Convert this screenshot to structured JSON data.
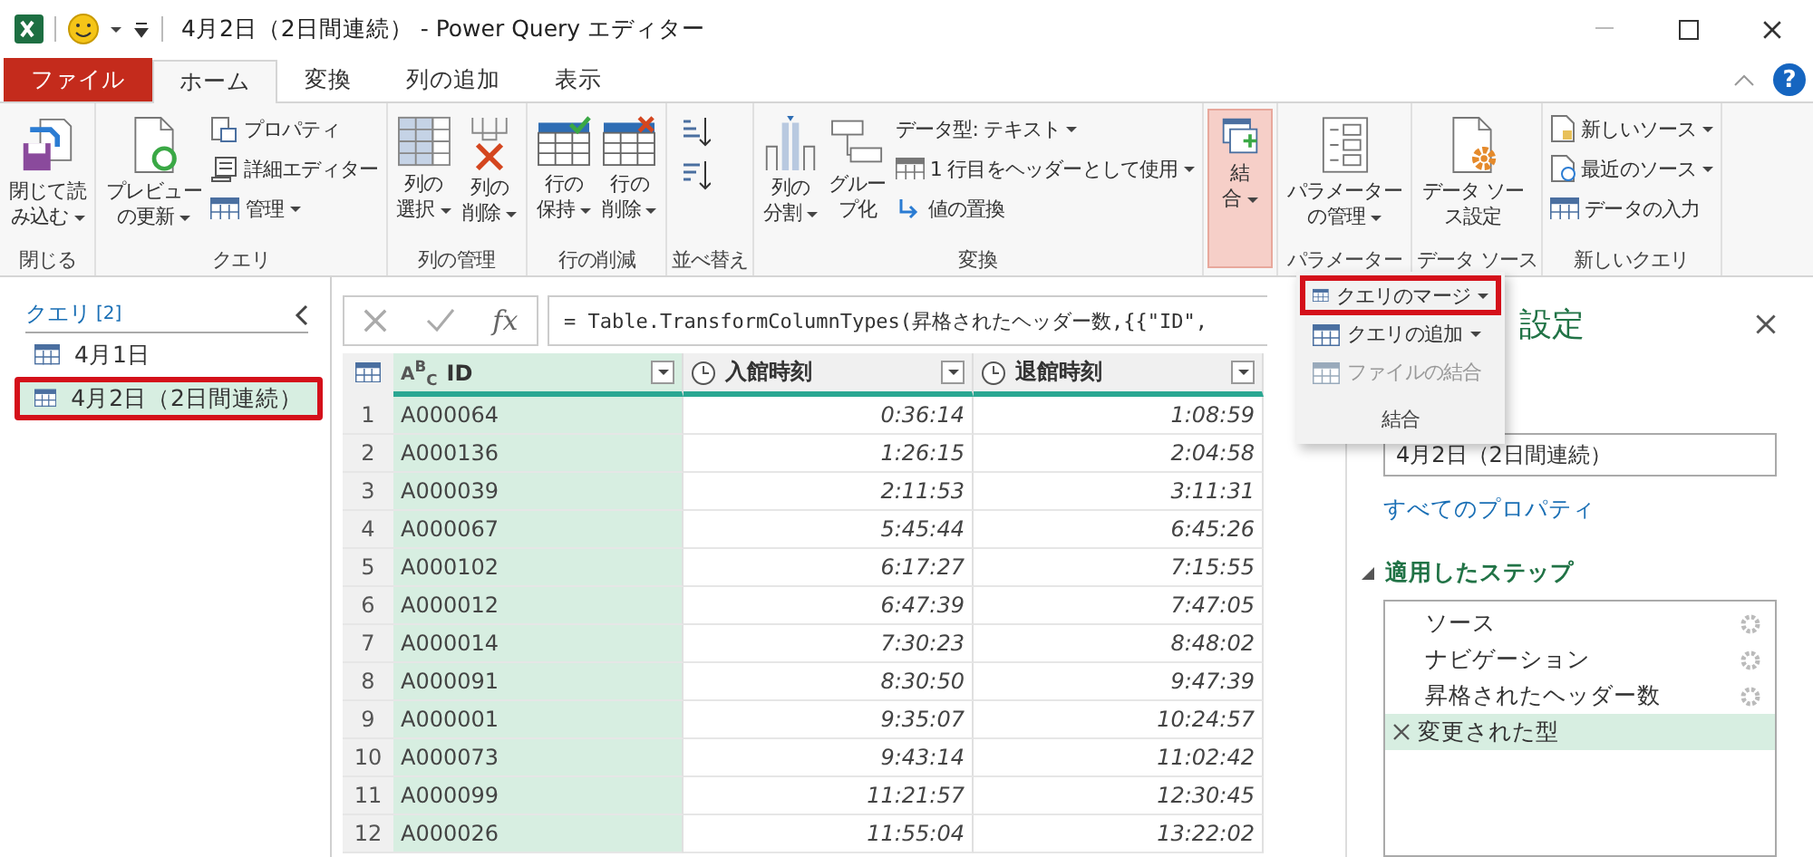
{
  "window": {
    "title": "4月2日（2日間連続） - Power Query エディター"
  },
  "tabs": [
    {
      "label": "ファイル",
      "kind": "file",
      "selected": false
    },
    {
      "label": "ホーム",
      "kind": "tab",
      "selected": true
    },
    {
      "label": "変換",
      "kind": "tab",
      "selected": false
    },
    {
      "label": "列の追加",
      "kind": "tab",
      "selected": false
    },
    {
      "label": "表示",
      "kind": "tab",
      "selected": false
    }
  ],
  "help": "?",
  "ribbon": {
    "groups": [
      {
        "label": "閉じる",
        "items": [
          {
            "kind": "large",
            "lines": [
              "閉じて読",
              "み込む"
            ],
            "caret": true
          }
        ]
      },
      {
        "label": "クエリ",
        "items": [
          {
            "kind": "large",
            "lines": [
              "プレビュー",
              "の更新"
            ],
            "caret": true
          },
          {
            "kind": "small",
            "label": "プロパティ",
            "caret": false
          },
          {
            "kind": "small",
            "label": "詳細エディター",
            "caret": false
          },
          {
            "kind": "small",
            "label": "管理",
            "caret": true
          }
        ]
      },
      {
        "label": "列の管理",
        "items": [
          {
            "kind": "large",
            "lines": [
              "列の",
              "選択"
            ],
            "caret": true
          },
          {
            "kind": "large",
            "lines": [
              "列の",
              "削除"
            ],
            "caret": true
          }
        ]
      },
      {
        "label": "行の削減",
        "items": [
          {
            "kind": "large",
            "lines": [
              "行の",
              "保持"
            ],
            "caret": true
          },
          {
            "kind": "large",
            "lines": [
              "行の",
              "削除"
            ],
            "caret": true
          }
        ]
      },
      {
        "label": "並べ替え",
        "items": [
          {
            "kind": "sort_ascending"
          },
          {
            "kind": "sort_descending"
          }
        ]
      },
      {
        "label": "変換",
        "items": [
          {
            "kind": "large",
            "lines": [
              "列の",
              "分割"
            ],
            "caret": true
          },
          {
            "kind": "large",
            "lines": [
              "グルー",
              "プ化"
            ],
            "caret": false
          },
          {
            "kind": "small",
            "label": "データ型: テキスト",
            "caret": true
          },
          {
            "kind": "small",
            "label": "1 行目をヘッダーとして使用",
            "caret": true
          },
          {
            "kind": "small",
            "label": "値の置換",
            "caret": false
          }
        ]
      },
      {
        "items": [
          {
            "kind": "large",
            "lines": [
              "結",
              "合"
            ],
            "caret": true,
            "expanded": true
          }
        ]
      },
      {
        "label": "パラメーター",
        "items": [
          {
            "kind": "large",
            "lines": [
              "パラメーター",
              "の管理"
            ],
            "caret": true
          }
        ]
      },
      {
        "label": "データ ソース",
        "items": [
          {
            "kind": "large",
            "lines": [
              "データ ソー",
              "ス設定"
            ],
            "caret": false
          }
        ]
      },
      {
        "label": "新しいクエリ",
        "items": [
          {
            "kind": "small",
            "label": "新しいソース",
            "caret": true
          },
          {
            "kind": "small",
            "label": "最近のソース",
            "caret": true
          },
          {
            "kind": "small",
            "label": "データの入力",
            "caret": false
          }
        ]
      }
    ]
  },
  "merge_menu": {
    "items": [
      {
        "label": "クエリのマージ",
        "caret": true,
        "disabled": false,
        "highlighted": true
      },
      {
        "label": "クエリの追加",
        "caret": true,
        "disabled": false,
        "highlighted": false
      },
      {
        "label": "ファイルの結合",
        "caret": false,
        "disabled": true,
        "highlighted": false
      }
    ],
    "footer": "結合"
  },
  "queries": {
    "title": "クエリ",
    "count": "[2]",
    "items": [
      {
        "name": "4月1日",
        "selected": false,
        "highlighted": false
      },
      {
        "name": "4月2日（2日間連続）",
        "selected": true,
        "highlighted": true
      }
    ]
  },
  "formula_bar": {
    "fx": "fx",
    "formula": "= Table.TransformColumnTypes(昇格されたヘッダー数,{{\"ID\","
  },
  "table": {
    "columns": [
      {
        "name": "ID",
        "kind": "text",
        "type_label": "A$^{B}$$_{C}$",
        "selected": true
      },
      {
        "name": "入館時刻",
        "kind": "time",
        "selected": false
      },
      {
        "name": "退館時刻",
        "kind": "time",
        "selected": false
      }
    ],
    "rows": [
      {
        "row_number": "1",
        "cells": [
          "A000064",
          "0:36:14",
          "1:08:59"
        ]
      },
      {
        "row_number": "2",
        "cells": [
          "A000136",
          "1:26:15",
          "2:04:58"
        ]
      },
      {
        "row_number": "3",
        "cells": [
          "A000039",
          "2:11:53",
          "3:11:31"
        ]
      },
      {
        "row_number": "4",
        "cells": [
          "A000067",
          "5:45:44",
          "6:45:26"
        ]
      },
      {
        "row_number": "5",
        "cells": [
          "A000102",
          "6:17:27",
          "7:15:55"
        ]
      },
      {
        "row_number": "6",
        "cells": [
          "A000012",
          "6:47:39",
          "7:47:05"
        ]
      },
      {
        "row_number": "7",
        "cells": [
          "A000014",
          "7:30:23",
          "8:48:02"
        ]
      },
      {
        "row_number": "8",
        "cells": [
          "A000091",
          "8:30:50",
          "9:47:39"
        ]
      },
      {
        "row_number": "9",
        "cells": [
          "A000001",
          "9:35:07",
          "10:24:57"
        ]
      },
      {
        "row_number": "10",
        "cells": [
          "A000073",
          "9:43:14",
          "11:02:42"
        ]
      },
      {
        "row_number": "11",
        "cells": [
          "A000099",
          "11:21:57",
          "12:30:45"
        ]
      },
      {
        "row_number": "12",
        "cells": [
          "A000026",
          "11:55:04",
          "13:22:02"
        ]
      }
    ]
  },
  "settings": {
    "title": "設定",
    "name_value": "4月2日（2日間連続）",
    "all_properties": "すべてのプロパティ",
    "steps_title": "適用したステップ",
    "steps": [
      {
        "name": "ソース",
        "has_settings": true,
        "selected": false
      },
      {
        "name": "ナビゲーション",
        "has_settings": true,
        "selected": false
      },
      {
        "name": "昇格されたヘッダー数",
        "has_settings": true,
        "selected": false
      },
      {
        "name": "変更された型",
        "has_settings": false,
        "selected": true
      }
    ]
  }
}
